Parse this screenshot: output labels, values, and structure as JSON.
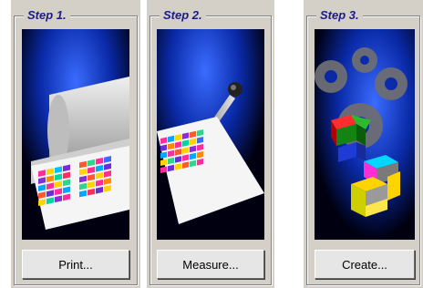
{
  "steps": [
    {
      "title": "Step 1.",
      "button_label": "Print..."
    },
    {
      "title": "Step 2.",
      "button_label": "Measure..."
    },
    {
      "title": "Step 3.",
      "button_label": "Create..."
    }
  ],
  "colors": {
    "panel_bg": "#d4d0c8",
    "title_text": "#1a1a8a",
    "art_blue": "#1a4aff",
    "art_black": "#000000"
  },
  "icons": {
    "step1": "printer-with-color-chart",
    "step2": "spectrophotometer-measuring-chart",
    "step3": "gears-and-color-cubes"
  }
}
